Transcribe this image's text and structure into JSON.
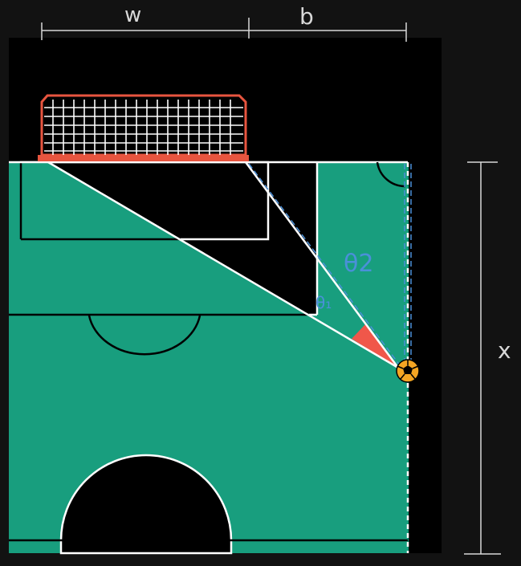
{
  "labels": {
    "w": "w",
    "b": "b",
    "x": "x",
    "theta1": "θ₁",
    "theta2": "θ2"
  },
  "colors": {
    "background": "#121212",
    "field_black": "#000000",
    "grass": "#189e7e",
    "line_white": "#ffffff",
    "goal_red": "#e8553f",
    "angle_red": "#f0574a",
    "annotation_blue": "#4a90d9",
    "ball_orange": "#f5a623",
    "sketch_grey": "#d8d8d8"
  },
  "icons": {
    "ball": "soccer-ball-icon",
    "goal": "goal-net-icon"
  }
}
